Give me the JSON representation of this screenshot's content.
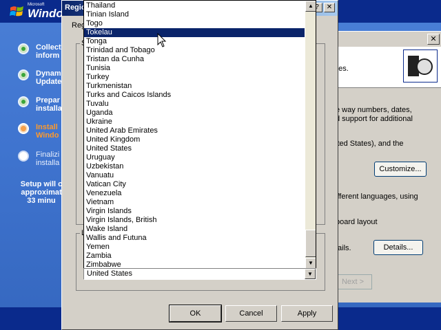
{
  "setup": {
    "logo_ms": "Microsoft",
    "logo_text": "Windo",
    "steps": [
      {
        "label": "Collect\ninform",
        "state": "done"
      },
      {
        "label": "Dynam\nUpdate",
        "state": "done"
      },
      {
        "label": "Prepar\ninstalla",
        "state": "done"
      },
      {
        "label": "Install\nWindo",
        "state": "current"
      },
      {
        "label": "Finalizi\ninstalla",
        "state": "future"
      }
    ],
    "eta": "Setup will c\napproximat\n33 minu"
  },
  "background_dialog": {
    "close_glyph": "✕",
    "header_text": "ges.",
    "text_lines": [
      "e way numbers, dates,",
      "d support for additional",
      "ited States), and the",
      "ifferent languages, using",
      "board layout",
      "tails."
    ],
    "customize_label": "Customize...",
    "details_label": "Details...",
    "next_label": "Next >"
  },
  "front_dialog": {
    "title": "Regio",
    "tab_label": "Reg",
    "group1_label": "S",
    "group2_label": "L",
    "ok_label": "OK",
    "cancel_label": "Cancel",
    "apply_label": "Apply",
    "help_glyph": "?",
    "close_glyph": "✕"
  },
  "dropdown": {
    "items": [
      "Thailand",
      "Tinian Island",
      "Togo",
      "Tokelau",
      "Tonga",
      "Trinidad and Tobago",
      "Tristan da Cunha",
      "Tunisia",
      "Turkey",
      "Turkmenistan",
      "Turks and Caicos Islands",
      "Tuvalu",
      "Uganda",
      "Ukraine",
      "United Arab Emirates",
      "United Kingdom",
      "United States",
      "Uruguay",
      "Uzbekistan",
      "Vanuatu",
      "Vatican City",
      "Venezuela",
      "Vietnam",
      "Virgin Islands",
      "Virgin Islands, British",
      "Wake Island",
      "Wallis and Futuna",
      "Yemen",
      "Zambia",
      "Zimbabwe"
    ],
    "highlighted_index": 3,
    "selected_value": "United States",
    "scroll_up_glyph": "▲",
    "scroll_down_glyph": "▼",
    "combo_arrow_glyph": "▼"
  }
}
